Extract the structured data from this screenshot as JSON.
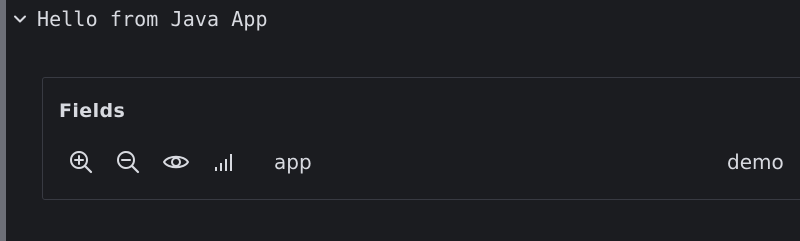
{
  "log_entry": {
    "message": "Hello from Java App",
    "expanded": true,
    "chevron_icon": "chevron-down-icon"
  },
  "details": {
    "heading": "Fields",
    "fields": [
      {
        "key": "app",
        "value": "demo",
        "actions": [
          {
            "icon": "zoom-in-icon",
            "label": "Filter for value"
          },
          {
            "icon": "zoom-out-icon",
            "label": "Filter out value"
          },
          {
            "icon": "eye-icon",
            "label": "Show field"
          },
          {
            "icon": "bar-chart-icon",
            "label": "Statistics"
          }
        ]
      }
    ]
  },
  "colors": {
    "background": "#1b1c20",
    "panel_border": "#383a42",
    "text": "#d8dae0",
    "left_bar": "#6d6f77"
  }
}
